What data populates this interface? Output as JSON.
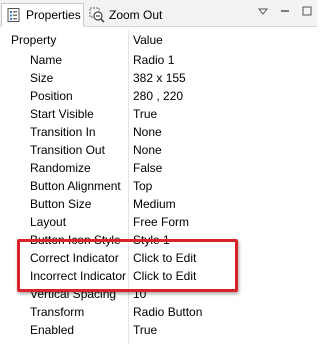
{
  "tabs": [
    {
      "label": "Properties",
      "icon": "properties-icon"
    },
    {
      "label": "Zoom Out",
      "icon": "zoom-out-icon"
    }
  ],
  "header": {
    "property": "Property",
    "value": "Value"
  },
  "rows": [
    {
      "name": "Name",
      "value": "Radio 1"
    },
    {
      "name": "Size",
      "value": "382 x 155"
    },
    {
      "name": "Position",
      "value": "280 , 220"
    },
    {
      "name": "Start Visible",
      "value": "True"
    },
    {
      "name": "Transition In",
      "value": "None"
    },
    {
      "name": "Transition Out",
      "value": "None"
    },
    {
      "name": "Randomize",
      "value": "False"
    },
    {
      "name": "Button Alignment",
      "value": "Top"
    },
    {
      "name": "Button Size",
      "value": "Medium"
    },
    {
      "name": "Layout",
      "value": "Free Form"
    },
    {
      "name": "Button Icon Style",
      "value": "Style 1"
    },
    {
      "name": "Correct Indicator",
      "value": "Click to Edit"
    },
    {
      "name": "Incorrect Indicator",
      "value": "Click to Edit"
    },
    {
      "name": "Vertical Spacing",
      "value": "10"
    },
    {
      "name": "Transform",
      "value": "Radio Button"
    },
    {
      "name": "Enabled",
      "value": "True"
    }
  ],
  "colors": {
    "highlight": "#d8232a"
  }
}
